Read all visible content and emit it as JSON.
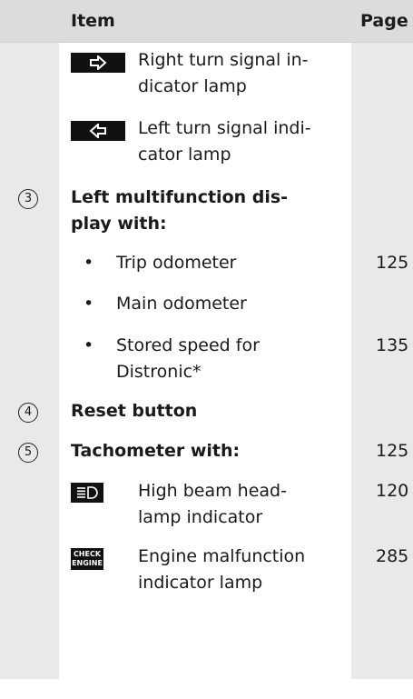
{
  "header": {
    "item": "Item",
    "page": "Page"
  },
  "rows": {
    "right_signal": {
      "line1": "Right turn signal in-",
      "line2": "dicator lamp"
    },
    "left_signal": {
      "line1": "Left turn signal indi-",
      "line2": "cator lamp"
    },
    "item3": {
      "num": "3",
      "line1": "Left multifunction dis-",
      "line2": "play with:"
    },
    "trip": {
      "bullet": "•",
      "text": "Trip odometer",
      "page": "125"
    },
    "main": {
      "bullet": "•",
      "text": "Main odometer"
    },
    "stored": {
      "bullet": "•",
      "line1": "Stored speed for",
      "line2": "Distronic*",
      "page": "135"
    },
    "item4": {
      "num": "4",
      "text": "Reset button"
    },
    "item5": {
      "num": "5",
      "text": "Tachometer with:",
      "page": "125"
    },
    "high_beam": {
      "line1": "High beam head-",
      "line2": "lamp indicator",
      "page": "120"
    },
    "engine": {
      "line1": "Engine malfunction",
      "line2": "indicator lamp",
      "page": "285",
      "icon_line1": "CHECK",
      "icon_line2": "ENGINE"
    }
  },
  "icons": {
    "right_signal": "right-arrow-icon",
    "left_signal": "left-arrow-icon",
    "high_beam": "high-beam-icon",
    "engine": "check-engine-icon"
  }
}
